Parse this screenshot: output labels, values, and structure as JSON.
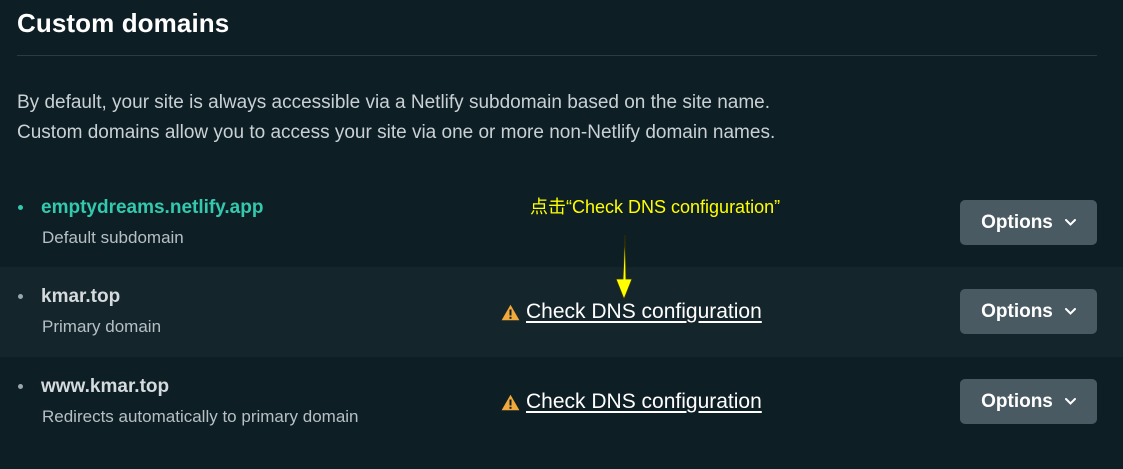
{
  "page": {
    "title": "Custom domains",
    "description": [
      "By default, your site is always accessible via a Netlify subdomain based on the site name.",
      "Custom domains allow you to access your site via one or more non-Netlify domain names."
    ]
  },
  "domains": [
    {
      "name": "emptydreams.netlify.app",
      "subtitle": "Default subdomain",
      "dns_link": "",
      "options_label": "Options"
    },
    {
      "name": "kmar.top",
      "subtitle": "Primary domain",
      "dns_link": "Check DNS configuration",
      "options_label": "Options"
    },
    {
      "name": "www.kmar.top",
      "subtitle": "Redirects automatically to primary domain",
      "dns_link": "Check DNS configuration",
      "options_label": "Options"
    }
  ],
  "annotation": {
    "text": "点击“Check DNS configuration”",
    "color": "#ffff00"
  },
  "colors": {
    "background": "#0e1e25",
    "row_alt": "#15252c",
    "accent_teal": "#32c9ae",
    "button": "#4a5a62",
    "warning": "#f0a93b"
  },
  "icons": {
    "warning": "warning-triangle-icon",
    "chevron": "chevron-down-icon"
  }
}
